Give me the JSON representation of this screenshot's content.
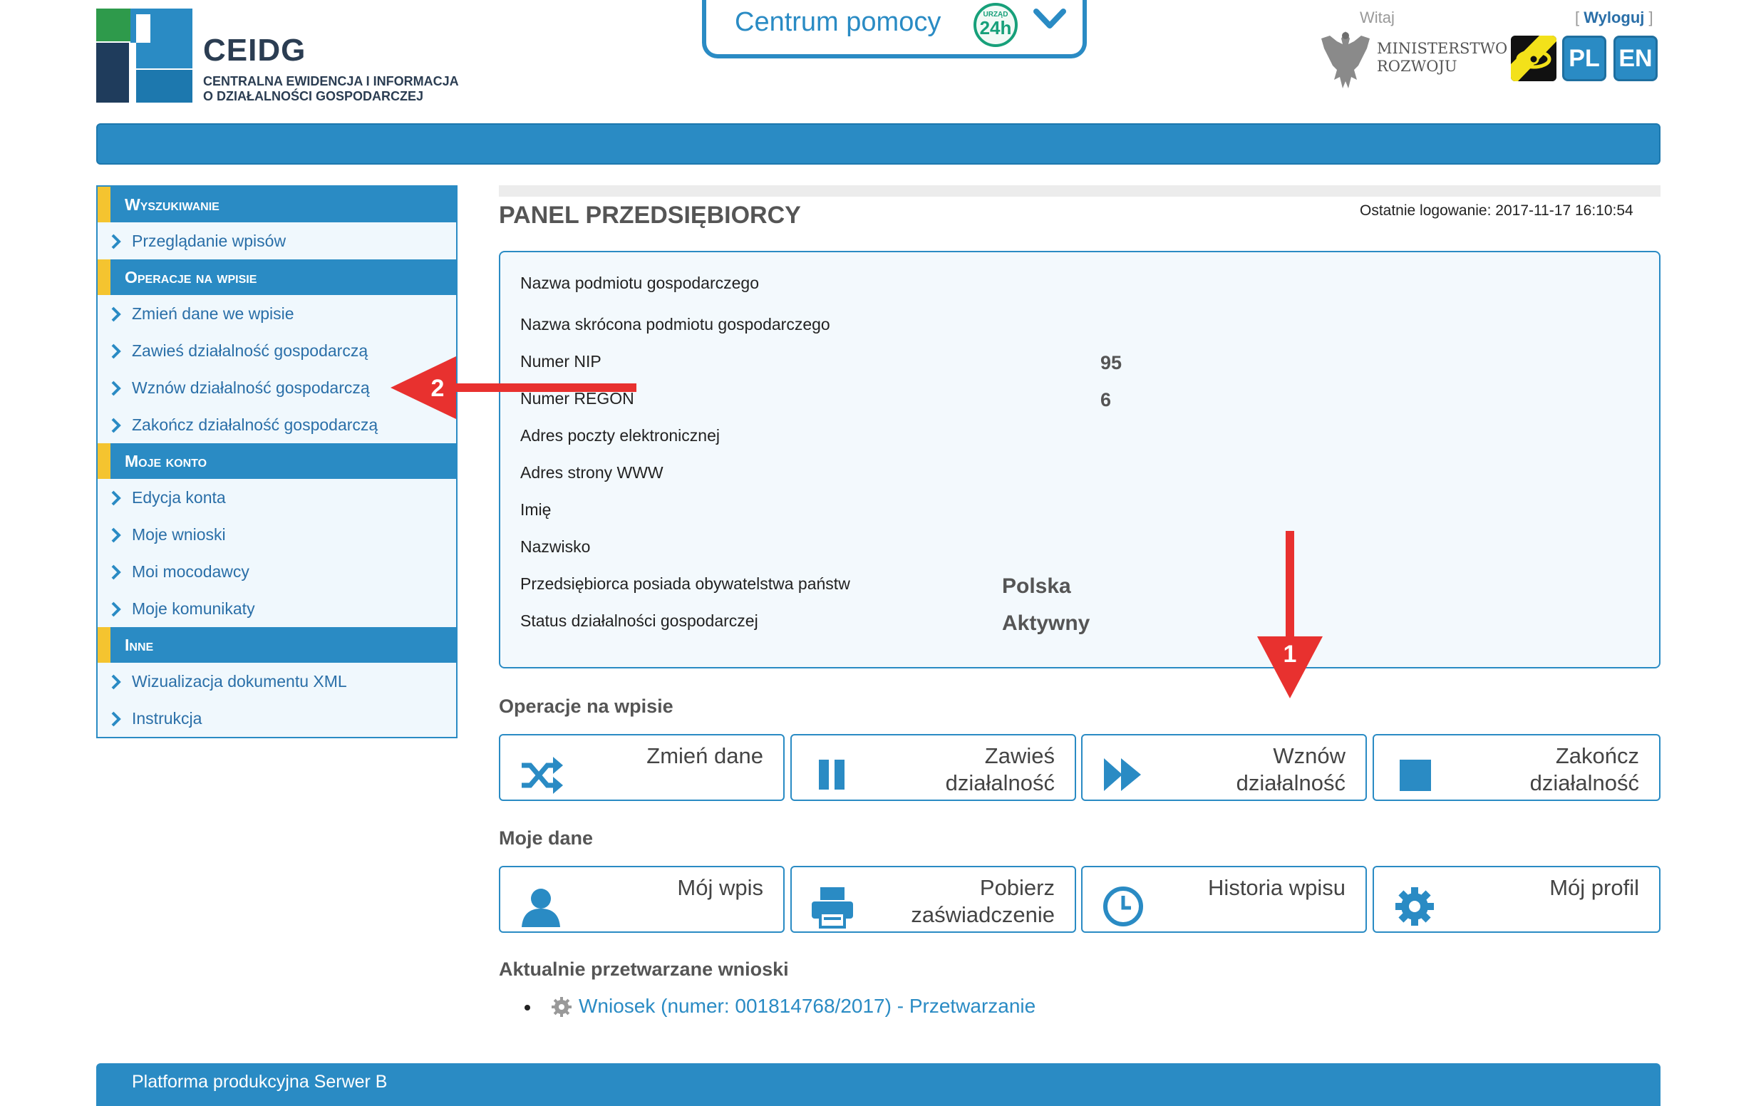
{
  "header": {
    "logo_title": "CEIDG",
    "logo_subtitle_line1": "CENTRALNA EWIDENCJA I INFORMACJA",
    "logo_subtitle_line2": "O DZIAŁALNOŚCI GOSPODARCZEJ",
    "help_label": "Centrum pomocy",
    "help_badge_top": "URZĄD",
    "help_badge_main": "24h",
    "greeting": "Witaj",
    "logout_open": "[ ",
    "logout_label": "Wyloguj",
    "logout_close": " ]",
    "ministry_line1": "MINISTERSTWO",
    "ministry_line2": "ROZWOJU",
    "lang_pl": "PL",
    "lang_en": "EN"
  },
  "sidebar": {
    "sections": [
      {
        "title": "Wyszukiwanie",
        "items": [
          "Przeglądanie wpisów"
        ]
      },
      {
        "title": "Operacje na wpisie",
        "items": [
          "Zmień dane we wpisie",
          "Zawieś działalność gospodarczą",
          "Wznów działalność gospodarczą",
          "Zakończ działalność gospodarczą"
        ]
      },
      {
        "title": "Moje konto",
        "items": [
          "Edycja konta",
          "Moje wnioski",
          "Moi mocodawcy",
          "Moje komunikaty"
        ]
      },
      {
        "title": "Inne",
        "items": [
          "Wizualizacja dokumentu XML",
          "Instrukcja"
        ]
      }
    ]
  },
  "main": {
    "title": "PANEL PRZEDSIĘBIORCY",
    "last_login": "Ostatnie logowanie: 2017-11-17 16:10:54",
    "fields": [
      {
        "label": "Nazwa podmiotu gospodarczego",
        "value": ""
      },
      {
        "label": "Nazwa skrócona podmiotu gospodarczego",
        "value": ""
      },
      {
        "label": "Numer NIP",
        "value": "95"
      },
      {
        "label": "Numer REGON",
        "value": "6"
      },
      {
        "label": "Adres poczty elektronicznej",
        "value": ""
      },
      {
        "label": "Adres strony WWW",
        "value": ""
      },
      {
        "label": "Imię",
        "value": ""
      },
      {
        "label": "Nazwisko",
        "value": ""
      },
      {
        "label": "Przedsiębiorca posiada obywatelstwa państw",
        "value": "Polska"
      },
      {
        "label": "Status działalności gospodarczej",
        "value": "Aktywny"
      }
    ],
    "operations_heading": "Operacje na wpisie",
    "operations": [
      {
        "line1": "Zmień dane",
        "line2": "",
        "icon": "shuffle-icon"
      },
      {
        "line1": "Zawieś",
        "line2": "działalność",
        "icon": "pause-icon"
      },
      {
        "line1": "Wznów",
        "line2": "działalność",
        "icon": "fast-forward-icon"
      },
      {
        "line1": "Zakończ",
        "line2": "działalność",
        "icon": "stop-icon"
      }
    ],
    "mydata_heading": "Moje dane",
    "mydata": [
      {
        "line1": "Mój wpis",
        "line2": "",
        "icon": "user-icon"
      },
      {
        "line1": "Pobierz",
        "line2": "zaświadczenie",
        "icon": "printer-icon"
      },
      {
        "line1": "Historia wpisu",
        "line2": "",
        "icon": "clock-icon"
      },
      {
        "line1": "Mój profil",
        "line2": "",
        "icon": "gear-icon"
      }
    ],
    "requests_heading": "Aktualnie przetwarzane wnioski",
    "request_link": "Wniosek (numer: 001814768/2017) - Przetwarzanie"
  },
  "annotations": {
    "arrow1": "1",
    "arrow2": "2"
  },
  "footer": {
    "text": "Platforma produkcyjna Serwer B"
  },
  "colors": {
    "primary": "#2a8bc4",
    "accent_yellow": "#f4c430",
    "annotation_red": "#e8312f"
  }
}
